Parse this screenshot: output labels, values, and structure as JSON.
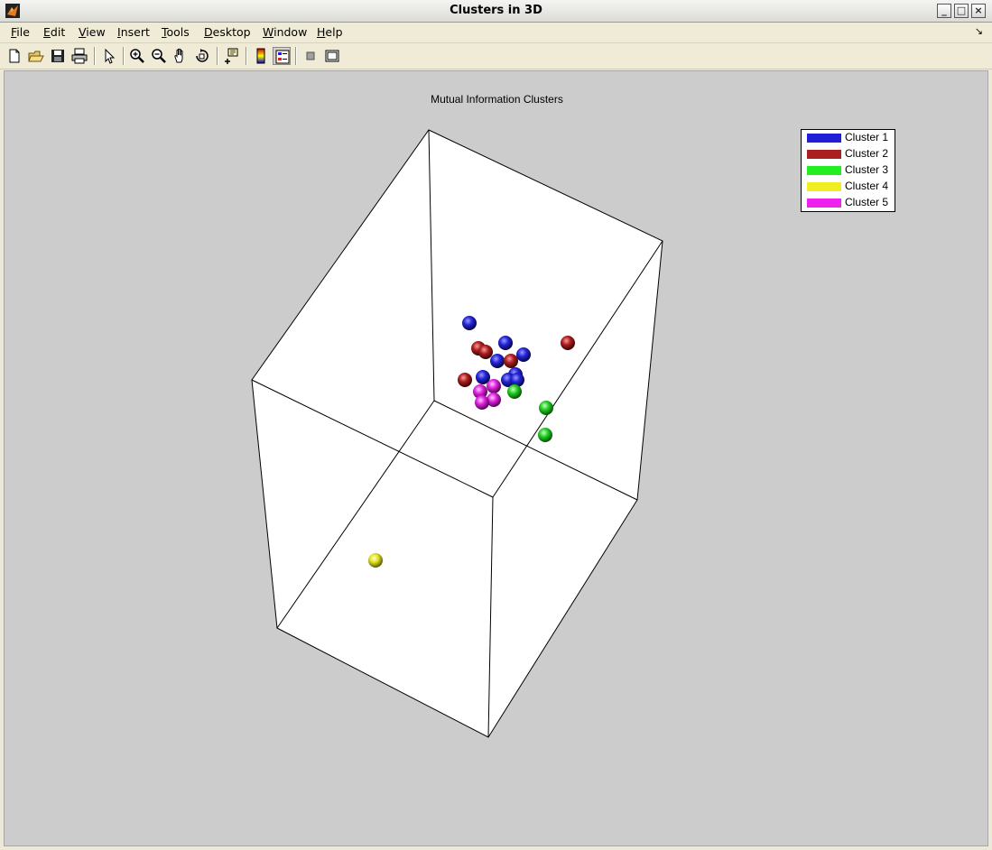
{
  "window": {
    "title": "Clusters in 3D",
    "minimize_glyph": "_",
    "maximize_glyph": "□",
    "close_glyph": "×"
  },
  "menu": [
    {
      "label": "File",
      "mnemonic": "F",
      "rest": "ile"
    },
    {
      "label": "Edit",
      "mnemonic": "E",
      "rest": "dit"
    },
    {
      "label": "View",
      "mnemonic": "V",
      "rest": "iew"
    },
    {
      "label": "Insert",
      "mnemonic": "I",
      "rest": "nsert"
    },
    {
      "label": "Tools",
      "mnemonic": "T",
      "rest": "ools"
    },
    {
      "label": "Desktop",
      "mnemonic": "D",
      "rest": "esktop"
    },
    {
      "label": "Window",
      "mnemonic": "W",
      "rest": "indow"
    },
    {
      "label": "Help",
      "mnemonic": "H",
      "rest": "elp"
    }
  ],
  "dock_glyph": "↘",
  "toolbar": {
    "icons": [
      "new-figure-icon",
      "open-file-icon",
      "save-icon",
      "print-icon",
      "edit-plot-arrow-icon",
      "zoom-in-icon",
      "zoom-out-icon",
      "pan-hand-icon",
      "rotate-3d-icon",
      "data-cursor-icon",
      "colorbar-icon",
      "legend-icon",
      "hide-plot-tools-icon",
      "show-plot-tools-icon"
    ]
  },
  "plot": {
    "title": "Mutual Information Clusters",
    "legend": [
      {
        "label": "Cluster 1",
        "color": "#1f1fd6"
      },
      {
        "label": "Cluster 2",
        "color": "#aa1f1f"
      },
      {
        "label": "Cluster 3",
        "color": "#22ee22"
      },
      {
        "label": "Cluster 4",
        "color": "#eeee22"
      },
      {
        "label": "Cluster 5",
        "color": "#ee22ee"
      }
    ]
  }
}
